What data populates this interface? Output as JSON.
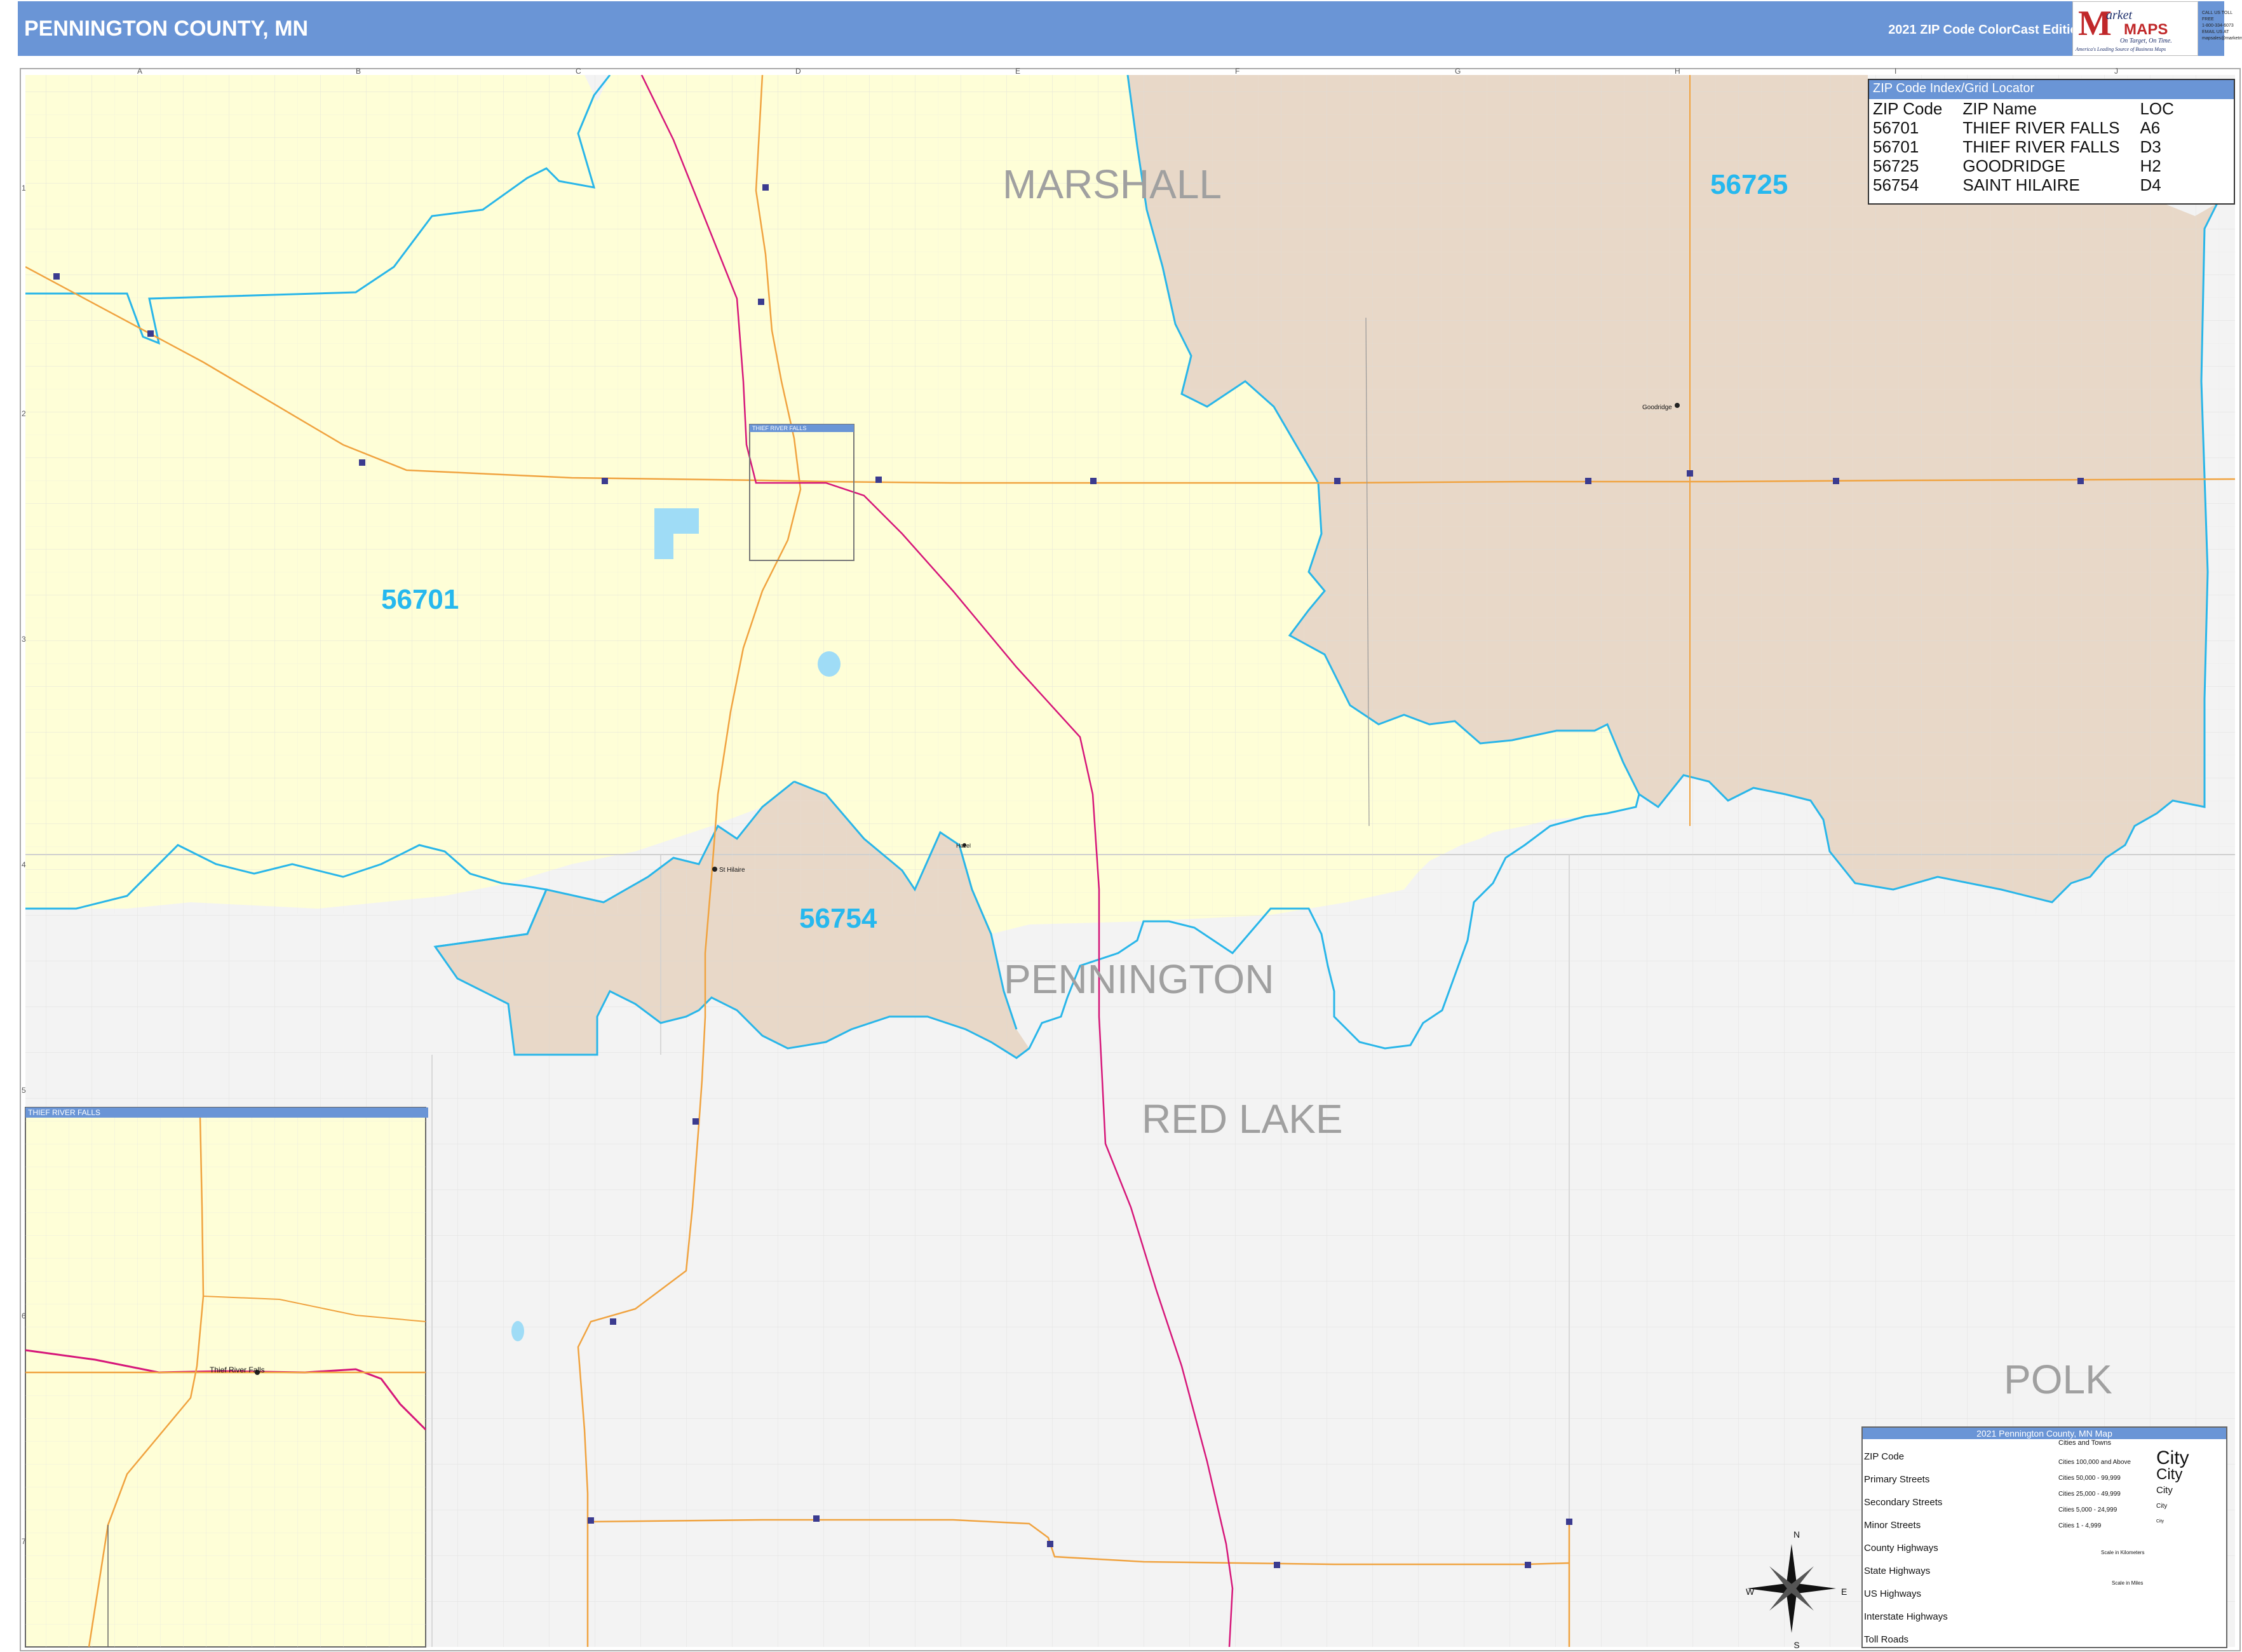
{
  "header": {
    "title": "PENNINGTON COUNTY, MN",
    "edition": "2021 ZIP Code ColorCast Edition",
    "color": "#6a95d6"
  },
  "logo": {
    "m": "M",
    "arket": "arket",
    "maps": "MAPS",
    "tagline1": "On Target, On Time.",
    "tagline2": "America's Leading Source of Business Maps"
  },
  "contact": [
    "CALL US TOLL FREE",
    "1-800-334-6073",
    "EMAIL US AT",
    "mapsales@marketmaps.com"
  ],
  "grid": {
    "columns": [
      "A",
      "B",
      "C",
      "D",
      "E",
      "F",
      "G",
      "H",
      "I",
      "J"
    ],
    "rows": [
      "1",
      "2",
      "3",
      "4",
      "5",
      "6",
      "7"
    ]
  },
  "counties": {
    "marshall": "MARSHALL",
    "pennington": "PENNINGTON",
    "red_lake": "RED LAKE",
    "polk": "POLK"
  },
  "zip_labels": {
    "z56701": "56701",
    "z56725": "56725",
    "z56754": "56754"
  },
  "places": {
    "goodridge": "Goodridge",
    "st_hilaire": "St Hilaire",
    "hazel": "Hazel",
    "trf": "Thief River Falls"
  },
  "zip_index": {
    "title": "ZIP Code Index/Grid Locator",
    "headers": [
      "ZIP Code",
      "ZIP Name",
      "LOC"
    ],
    "rows": [
      [
        "56701",
        "THIEF RIVER FALLS",
        "A6"
      ],
      [
        "56701",
        "THIEF RIVER FALLS",
        "D3"
      ],
      [
        "56725",
        "GOODRIDGE",
        "H2"
      ],
      [
        "56754",
        "SAINT HILAIRE",
        "D4"
      ]
    ]
  },
  "inset": {
    "title": "THIEF RIVER FALLS",
    "mini_title": "THIEF RIVER FALLS"
  },
  "legend": {
    "title": "2021 Pennington County, MN Map",
    "items": [
      "ZIP Code",
      "Primary Streets",
      "Secondary Streets",
      "Minor Streets",
      "County Highways",
      "State Highways",
      "US Highways",
      "Interstate Highways",
      "Toll Roads"
    ],
    "cities_header": "Cities and Towns",
    "cities": [
      {
        "range": "Cities 100,000 and Above",
        "label": "City"
      },
      {
        "range": "Cities 50,000 - 99,999",
        "label": "City"
      },
      {
        "range": "Cities 25,000 - 49,999",
        "label": "City"
      },
      {
        "range": "Cities 5,000 - 24,999",
        "label": "City"
      },
      {
        "range": "Cities 1 - 4,999",
        "label": "City"
      }
    ],
    "scale_km": "Scale in Kilometers",
    "scale_mi": "Scale in Miles"
  },
  "compass": {
    "n": "N",
    "s": "S",
    "e": "E",
    "w": "W"
  },
  "colors": {
    "zip_56701": "#fefed7",
    "zip_tan": "#e8d8c8",
    "outside": "#f3f3f3",
    "zip_border": "#29b6e9",
    "state_hwy": "#f0a340",
    "us_hwy": "#d6177a",
    "zip_label": "#26b8ee",
    "county_label": "#a0a0a0"
  }
}
